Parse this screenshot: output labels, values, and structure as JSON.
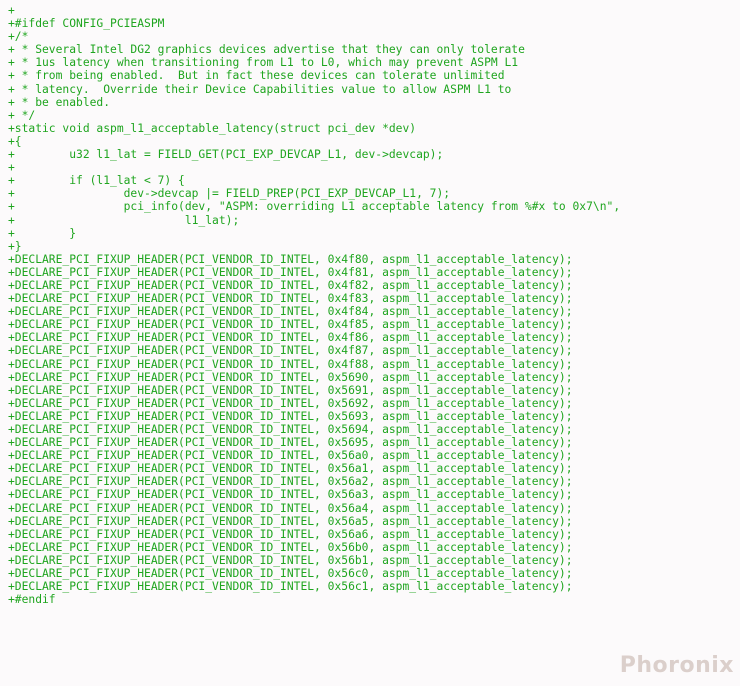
{
  "code": {
    "prefix": "+",
    "ifdef": "#ifdef CONFIG_PCIEASPM",
    "comment_open": "/*",
    "comment_l1": " * Several Intel DG2 graphics devices advertise that they can only tolerate",
    "comment_l2": " * 1us latency when transitioning from L1 to L0, which may prevent ASPM L1",
    "comment_l3": " * from being enabled.  But in fact these devices can tolerate unlimited",
    "comment_l4": " * latency.  Override their Device Capabilities value to allow ASPM L1 to",
    "comment_l5": " * be enabled.",
    "comment_close": " */",
    "fn_sig": "static void aspm_l1_acceptable_latency(struct pci_dev *dev)",
    "brace_open": "{",
    "decl": "        u32 l1_lat = FIELD_GET(PCI_EXP_DEVCAP_L1, dev->devcap);",
    "blank": "",
    "if_line": "        if (l1_lat < 7) {",
    "assign": "                dev->devcap |= FIELD_PREP(PCI_EXP_DEVCAP_L1, 7);",
    "pci_info": "                pci_info(dev, \"ASPM: overriding L1 acceptable latency from %#x to 0x7\\n\",",
    "pci_info_cont": "                         l1_lat);",
    "if_close": "        }",
    "brace_close": "}",
    "decl_macro": "DECLARE_PCI_FIXUP_HEADER(PCI_VENDOR_ID_INTEL, ",
    "decl_tail": ", aspm_l1_acceptable_latency);",
    "ids": [
      "0x4f80",
      "0x4f81",
      "0x4f82",
      "0x4f83",
      "0x4f84",
      "0x4f85",
      "0x4f86",
      "0x4f87",
      "0x4f88",
      "0x5690",
      "0x5691",
      "0x5692",
      "0x5693",
      "0x5694",
      "0x5695",
      "0x56a0",
      "0x56a1",
      "0x56a2",
      "0x56a3",
      "0x56a4",
      "0x56a5",
      "0x56a6",
      "0x56b0",
      "0x56b1",
      "0x56c0",
      "0x56c1"
    ],
    "endif": "#endif"
  },
  "watermark": "Phoronix"
}
